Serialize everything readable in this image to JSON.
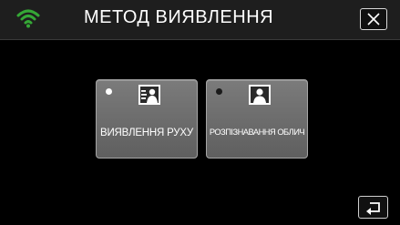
{
  "header": {
    "title": "МЕТОД ВИЯВЛЕННЯ",
    "wifi_icon": "wifi-icon",
    "close_icon": "close-icon",
    "wifi_color": "#35a836"
  },
  "options": [
    {
      "label": "ВИЯВЛЕННЯ РУХУ",
      "selected": true,
      "icon": "motion-detection-icon"
    },
    {
      "label": "РОЗПІЗНАВАННЯ ОБЛИЧ",
      "selected": false,
      "icon": "face-recognition-icon"
    }
  ],
  "footer": {
    "back_icon": "return-icon"
  }
}
